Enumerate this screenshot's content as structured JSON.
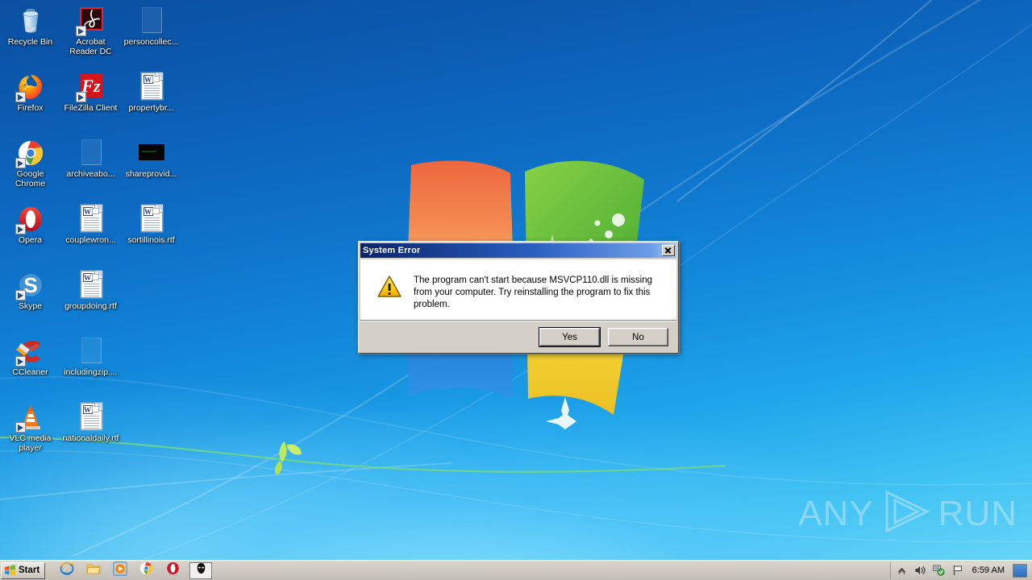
{
  "desktop": {
    "icons": [
      {
        "label": "Recycle Bin",
        "art": "recycle-bin",
        "shortcut": false,
        "name": "desktop-icon-recycle-bin"
      },
      {
        "label": "Acrobat\nReader DC",
        "art": "acrobat",
        "shortcut": true,
        "name": "desktop-icon-acrobat-reader-dc"
      },
      {
        "label": "personcollec...",
        "art": "blank-page",
        "shortcut": false,
        "name": "desktop-icon-personcollec"
      },
      {
        "label": "Firefox",
        "art": "firefox",
        "shortcut": true,
        "name": "desktop-icon-firefox"
      },
      {
        "label": "FileZilla Client",
        "art": "filezilla",
        "shortcut": true,
        "name": "desktop-icon-filezilla-client"
      },
      {
        "label": "propertybr...",
        "art": "rtf-document",
        "shortcut": false,
        "name": "desktop-icon-propertybr"
      },
      {
        "label": "Google\nChrome",
        "art": "chrome",
        "shortcut": true,
        "name": "desktop-icon-google-chrome"
      },
      {
        "label": "archiveabo...",
        "art": "blank-page",
        "shortcut": false,
        "name": "desktop-icon-archiveabo"
      },
      {
        "label": "shareprovid...",
        "art": "black-rect",
        "shortcut": false,
        "name": "desktop-icon-shareprovid"
      },
      {
        "label": "Opera",
        "art": "opera",
        "shortcut": true,
        "name": "desktop-icon-opera"
      },
      {
        "label": "couplewron...",
        "art": "rtf-document",
        "shortcut": false,
        "name": "desktop-icon-couplewron"
      },
      {
        "label": "sortillinois.rtf",
        "art": "rtf-document",
        "shortcut": false,
        "name": "desktop-icon-sortillinois-rtf"
      },
      {
        "label": "Skype",
        "art": "skype",
        "shortcut": true,
        "name": "desktop-icon-skype"
      },
      {
        "label": "groupdoing.rtf",
        "art": "rtf-document",
        "shortcut": false,
        "name": "desktop-icon-groupdoing-rtf"
      },
      {
        "label": "",
        "art": "empty",
        "shortcut": false,
        "name": "desktop-icon-empty-1"
      },
      {
        "label": "CCleaner",
        "art": "ccleaner",
        "shortcut": true,
        "name": "desktop-icon-ccleaner"
      },
      {
        "label": "includingzip....",
        "art": "blank-page",
        "shortcut": false,
        "name": "desktop-icon-includingzip"
      },
      {
        "label": "",
        "art": "empty",
        "shortcut": false,
        "name": "desktop-icon-empty-2"
      },
      {
        "label": "VLC media\nplayer",
        "art": "vlc",
        "shortcut": true,
        "name": "desktop-icon-vlc-media-player"
      },
      {
        "label": "nationaldaily.rtf",
        "art": "rtf-document",
        "shortcut": false,
        "name": "desktop-icon-nationaldaily-rtf"
      },
      {
        "label": "",
        "art": "empty",
        "shortcut": false,
        "name": "desktop-icon-empty-3"
      }
    ]
  },
  "dialog": {
    "title": "System Error",
    "message": "The program can't start because MSVCP110.dll is missing from your computer. Try reinstalling the program to fix this problem.",
    "icon": "warning-triangle-icon",
    "close_label": "×",
    "buttons": [
      {
        "label": "Yes",
        "default": true,
        "name": "dialog-yes-button"
      },
      {
        "label": "No",
        "default": false,
        "name": "dialog-no-button"
      }
    ]
  },
  "taskbar": {
    "start_label": "Start",
    "quicklaunch": [
      {
        "icon": "internet-explorer-icon",
        "name": "taskbar-internet-explorer"
      },
      {
        "icon": "windows-explorer-icon",
        "name": "taskbar-windows-explorer"
      },
      {
        "icon": "media-player-icon",
        "name": "taskbar-media-player"
      },
      {
        "icon": "chrome-icon",
        "name": "taskbar-chrome"
      },
      {
        "icon": "opera-icon",
        "name": "taskbar-opera"
      }
    ],
    "tasks": [
      {
        "icon": "dark-mask-icon",
        "name": "taskbar-task-active"
      }
    ],
    "tray": [
      {
        "icon": "show-hidden-icons-icon",
        "name": "tray-show-hidden-icons"
      },
      {
        "icon": "volume-icon",
        "name": "tray-volume"
      },
      {
        "icon": "network-icon",
        "name": "tray-network"
      },
      {
        "icon": "action-center-flag-icon",
        "name": "tray-action-center"
      }
    ],
    "clock": "6:59 AM"
  },
  "watermark": {
    "text_left": "ANY",
    "text_right": "RUN",
    "logo": "play-triangle-icon"
  },
  "colors": {
    "desktop_blue": "#1288da",
    "dialog_face": "#d4d0c8",
    "titlebar_blue": "#0a246a",
    "warning_yellow": "#ffcc00",
    "taskbar_gray": "#cdc9c0"
  }
}
